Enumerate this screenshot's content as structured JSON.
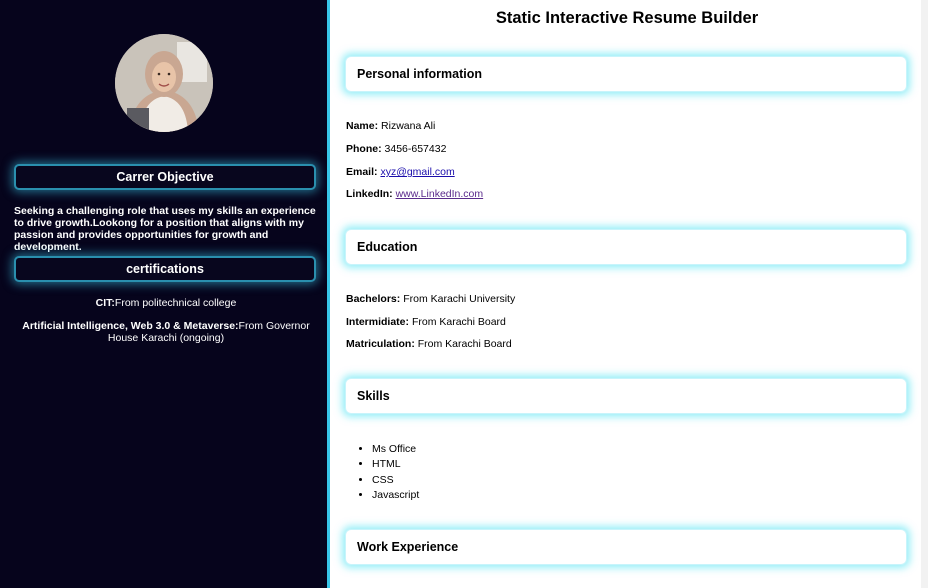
{
  "sidebar": {
    "avatar_alt": "profile photo",
    "objective_heading": "Carrer Objective",
    "objective_text": "Seeking a challenging role that uses my skills an experience to drive growth.Lookong for a position that aligns with my passion and provides opportunities for growth and development.",
    "certifications_heading": "certifications",
    "certifications": [
      {
        "title": "CIT:",
        "detail": "From politechnical college"
      },
      {
        "title": "Artificial Intelligence, Web 3.0 & Metaverse:",
        "detail": "From Governor House Karachi (ongoing)"
      }
    ]
  },
  "main": {
    "title": "Static Interactive Resume Builder",
    "personal": {
      "heading": "Personal information",
      "name_label": "Name:",
      "name_value": "Rizwana Ali",
      "phone_label": "Phone:",
      "phone_value": "3456-657432",
      "email_label": "Email:",
      "email_value": "xyz@gmail.com",
      "linkedin_label": "LinkedIn:",
      "linkedin_value": "www.LinkedIn.com"
    },
    "education": {
      "heading": "Education",
      "items": [
        {
          "label": "Bachelors:",
          "value": "From Karachi University"
        },
        {
          "label": "Intermidiate:",
          "value": "From Karachi Board"
        },
        {
          "label": "Matriculation:",
          "value": "From Karachi Board"
        }
      ]
    },
    "skills": {
      "heading": "Skills",
      "items": [
        "Ms Office",
        "HTML",
        "CSS",
        "Javascript"
      ]
    },
    "work": {
      "heading": "Work Experience"
    }
  },
  "colors": {
    "sidebar_bg": "#06041c",
    "glow_accent": "#38c6e8",
    "link": "#1a0dab",
    "link_visited": "#5a2a8c"
  }
}
